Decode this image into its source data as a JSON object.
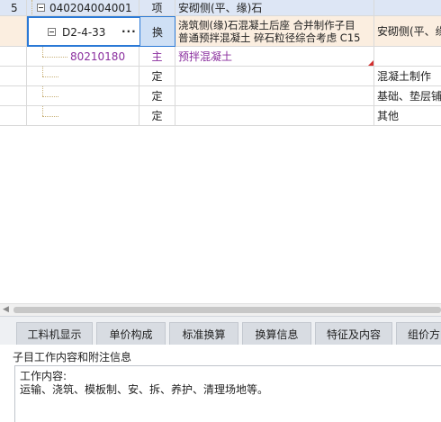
{
  "grid": {
    "rows": [
      {
        "index": "5",
        "code": "040204004001",
        "type": "项",
        "name": "安砌侧(平、缘)石",
        "spec": ""
      },
      {
        "index": "",
        "code": "D2-4-33",
        "code_menu": "···",
        "type": "换",
        "name_line1": "浇筑侧(缘)石混凝土后座  合并制作子目",
        "name_line2": "普通预拌混凝土 碎石粒径综合考虑 C15",
        "spec": "安砌侧(平、缘"
      },
      {
        "index": "",
        "code": "80210180",
        "type": "主",
        "name": "预拌混凝土",
        "spec": ""
      },
      {
        "index": "",
        "code": "",
        "type": "定",
        "name": "",
        "spec": "混凝土制作"
      },
      {
        "index": "",
        "code": "",
        "type": "定",
        "name": "",
        "spec": "基础、垫层铺"
      },
      {
        "index": "",
        "code": "",
        "type": "定",
        "name": "",
        "spec": "其他"
      }
    ]
  },
  "scrollbar": {
    "left_arrow": "◀"
  },
  "tabs": [
    "工料机显示",
    "单价构成",
    "标准换算",
    "换算信息",
    "特征及内容",
    "组价方"
  ],
  "panel": {
    "title": "子目工作内容和附注信息",
    "content_line1": "工作内容:",
    "content_line2": "运输、浇筑、模板制、安、拆、养护、清理场地等。"
  },
  "colors": {
    "section_row_bg": "#dde6f5",
    "quota_row_bg": "#fbeee0",
    "selection_border": "#2b79d6",
    "material_text": "#8a2e9e",
    "flag_red": "#d32f2f"
  }
}
